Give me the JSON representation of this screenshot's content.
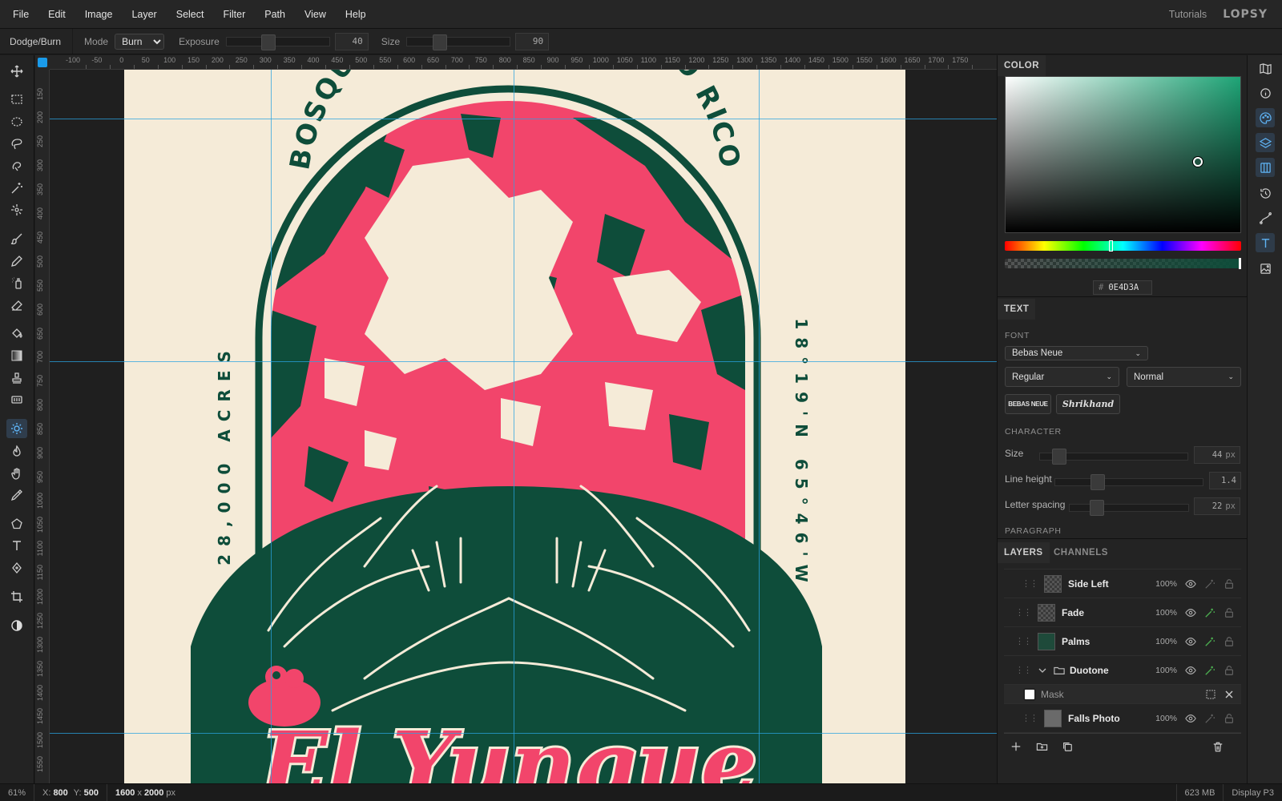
{
  "menubar": {
    "items": [
      "File",
      "Edit",
      "Image",
      "Layer",
      "Select",
      "Filter",
      "Path",
      "View",
      "Help"
    ],
    "tutorials": "Tutorials",
    "logo": "LOPSY"
  },
  "options": {
    "tool_name": "Dodge/Burn",
    "mode_label": "Mode",
    "mode_value": "Burn",
    "exposure_label": "Exposure",
    "exposure_value": "40",
    "exposure_level_percent": 40,
    "size_label": "Size",
    "size_value": "90"
  },
  "rulers": {
    "top": [
      "-100",
      "-50",
      "0",
      "50",
      "100",
      "150",
      "200",
      "250",
      "300",
      "350",
      "400",
      "450",
      "500",
      "550",
      "600",
      "650",
      "700",
      "750",
      "800",
      "850",
      "900",
      "950",
      "1000",
      "1050",
      "1100",
      "1150",
      "1200",
      "1250",
      "1300",
      "1350",
      "1400",
      "1450",
      "1500",
      "1550",
      "1600",
      "1650",
      "1700",
      "1750"
    ],
    "left": [
      "150",
      "200",
      "250",
      "300",
      "350",
      "400",
      "450",
      "500",
      "550",
      "600",
      "650",
      "700",
      "750",
      "800",
      "850",
      "900",
      "950",
      "1000",
      "1050",
      "1100",
      "1150",
      "1200",
      "1250",
      "1300",
      "1350",
      "1400",
      "1450",
      "1500",
      "1550"
    ]
  },
  "artwork": {
    "arc_text": "BOSQUE NACIONAL · PUERTO RICO",
    "left_text": "28,000 ACRES",
    "right_text": "18°19'N 65°46'W",
    "bottom_text": "El Yunque",
    "colors": {
      "cream": "#f5ebd8",
      "green": "#0e4d3a",
      "pink": "#f2456b"
    }
  },
  "color_panel": {
    "tab": "COLOR",
    "hex_prefix": "#",
    "hex": "0E4D3A",
    "accent": "#1a9bea"
  },
  "text_panel": {
    "tab": "TEXT",
    "font_label": "FONT",
    "font_family": "Bebas Neue",
    "style": "Regular",
    "variant": "Normal",
    "preset_1": "BEBAS NEUE",
    "preset_2": "Shrikhand",
    "character_label": "CHARACTER",
    "size_label": "Size",
    "size_value": "44",
    "size_unit": "px",
    "line_height_label": "Line height",
    "line_height_value": "1.4",
    "letter_spacing_label": "Letter spacing",
    "letter_spacing_value": "22",
    "letter_spacing_unit": "px",
    "paragraph_label": "PARAGRAPH"
  },
  "layers_panel": {
    "tab_layers": "LAYERS",
    "tab_channels": "CHANNELS",
    "layers": [
      {
        "name": "Side Left",
        "opacity": "100%"
      },
      {
        "name": "Fade",
        "opacity": "100%"
      },
      {
        "name": "Palms",
        "opacity": "100%"
      },
      {
        "name": "Duotone",
        "opacity": "100%"
      },
      {
        "name": "Mask",
        "opacity": ""
      },
      {
        "name": "Falls Photo",
        "opacity": "100%"
      }
    ]
  },
  "status": {
    "zoom": "61%",
    "x_label": "X:",
    "x_value": "800",
    "y_label": "Y:",
    "y_value": "500",
    "doc_w": "1600",
    "doc_x": "x",
    "doc_h": "2000",
    "doc_unit": "px",
    "memory": "623 MB",
    "profile": "Display P3"
  },
  "icons": {
    "tools": [
      "move-icon",
      "rect-marquee-icon",
      "ellipse-marquee-icon",
      "lasso-icon",
      "magnetic-lasso-icon",
      "magic-wand-icon",
      "quick-select-icon",
      "brush-icon",
      "pencil-icon",
      "spray-icon",
      "eraser-icon",
      "bucket-icon",
      "gradient-icon",
      "stamp-icon",
      "patch-icon",
      "dodge-icon",
      "burn-icon",
      "hand-icon",
      "eyedropper-icon",
      "polygon-icon",
      "type-icon",
      "pen-icon",
      "crop-icon",
      "contrast-icon"
    ],
    "strip": [
      "map-icon",
      "info-icon",
      "palette-icon",
      "layers-icon",
      "columns-icon",
      "history-icon",
      "path-icon",
      "text-icon",
      "image-edit-icon"
    ]
  }
}
